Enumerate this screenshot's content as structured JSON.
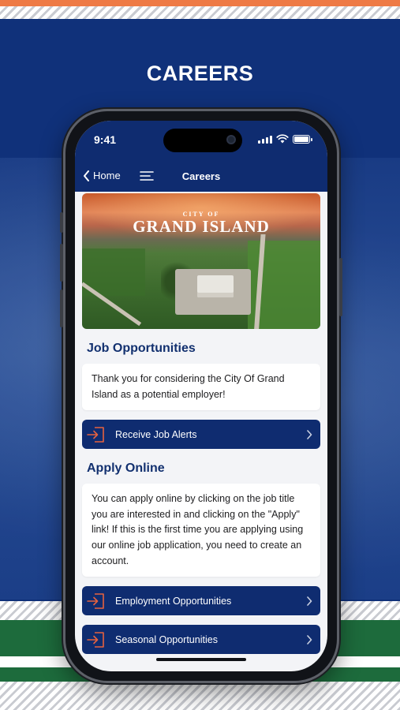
{
  "headline": "CAREERS",
  "status_bar": {
    "time": "9:41",
    "icons": [
      "signal-icon",
      "wifi-icon",
      "battery-icon"
    ]
  },
  "nav": {
    "back_label": "Home",
    "title": "Careers"
  },
  "hero": {
    "logo_small": "CITY OF",
    "logo_big": "GRAND ISLAND"
  },
  "sections": {
    "job_opportunities": {
      "title": "Job Opportunities",
      "body": "Thank you for considering the City Of Grand Island as a potential employer!",
      "action": "Receive Job Alerts"
    },
    "apply_online": {
      "title": "Apply Online",
      "body": "You can apply online by clicking on the job title you are interested in and clicking on the \"Apply\" link! If this is the first time you are applying using our online job application, you need to create an account.",
      "actions": [
        "Employment Opportunities",
        "Seasonal Opportunities"
      ]
    }
  },
  "colors": {
    "navy": "#0f2c70",
    "accent_orange": "#e5623f",
    "brand_green": "#1d6b3c"
  }
}
